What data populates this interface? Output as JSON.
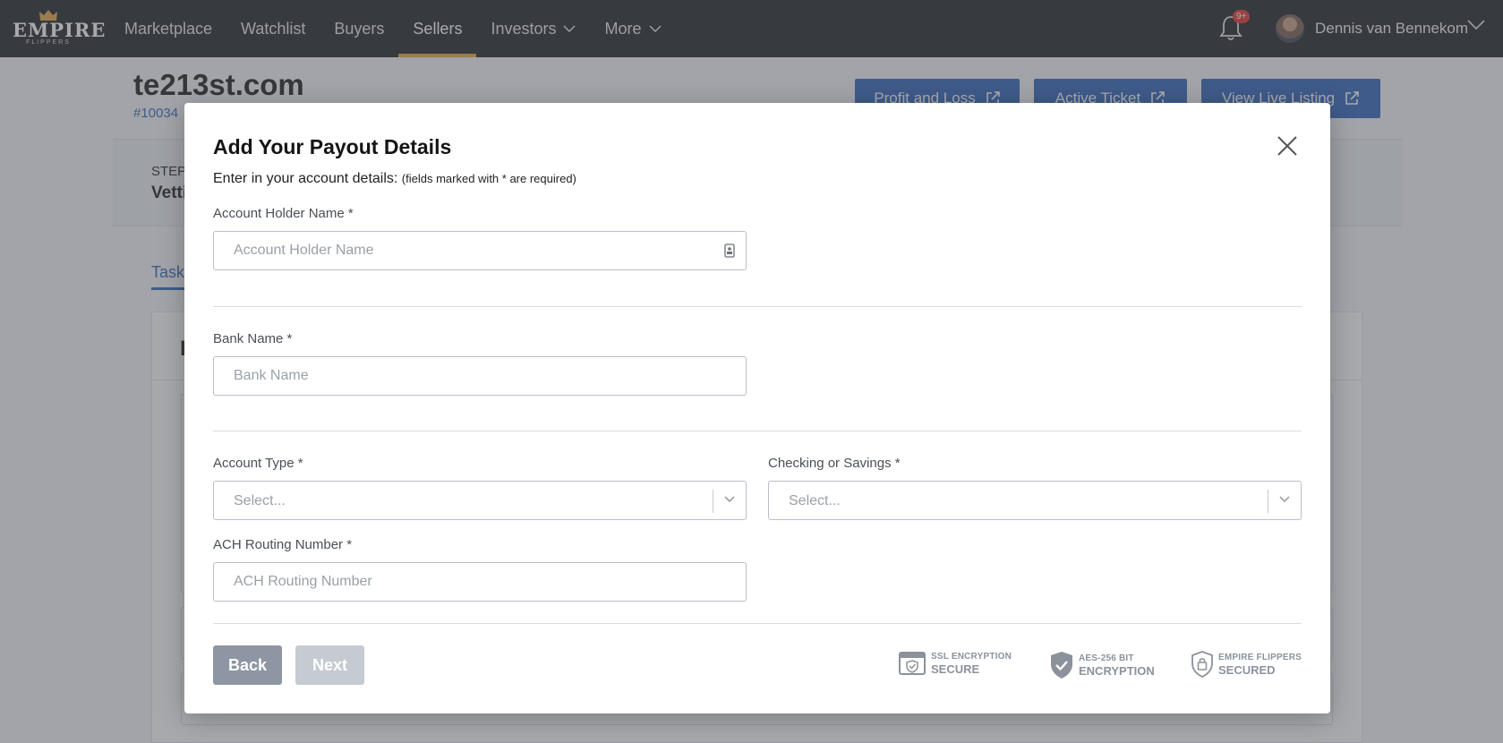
{
  "nav": {
    "logo_text": "EMPIRE",
    "logo_sub": "FLIPPERS",
    "links": [
      "Marketplace",
      "Watchlist",
      "Buyers",
      "Sellers",
      "Investors",
      "More"
    ],
    "active": "Sellers",
    "notification_badge": "9+",
    "user_name": "Dennis van Bennekom",
    "accent_color": "#e8a33d"
  },
  "page": {
    "title": "te213st.com",
    "id_text": "#10034",
    "buttons": [
      "Profit and Loss",
      "Active Ticket",
      "View Live Listing"
    ],
    "step_label": "STEP",
    "step_name": "Vetti",
    "tab": "Task",
    "card_header": "I",
    "brand_color": "#2e63b8"
  },
  "modal": {
    "title": "Add Your Payout Details",
    "intro": "Enter in your account details:",
    "intro_note": "(fields marked with * are required)",
    "fields": {
      "account_holder": {
        "label": "Account Holder Name *",
        "placeholder": "Account Holder Name",
        "value": ""
      },
      "bank_name": {
        "label": "Bank Name *",
        "placeholder": "Bank Name",
        "value": ""
      },
      "account_type": {
        "label": "Account Type *",
        "placeholder": "Select..."
      },
      "checking_savings": {
        "label": "Checking or Savings *",
        "placeholder": "Select..."
      },
      "ach_routing": {
        "label": "ACH Routing Number *",
        "placeholder": "ACH Routing Number",
        "value": ""
      }
    },
    "back_label": "Back",
    "next_label": "Next",
    "badges": [
      {
        "line1": "SSL ENCRYPTION",
        "line2": "SECURE",
        "icon": "browser-shield-icon"
      },
      {
        "line1": "AES-256 BIT",
        "line2": "ENCRYPTION",
        "icon": "shield-check-icon"
      },
      {
        "line1": "EMPIRE FLIPPERS",
        "line2": "SECURED",
        "icon": "lock-shield-icon"
      }
    ]
  }
}
